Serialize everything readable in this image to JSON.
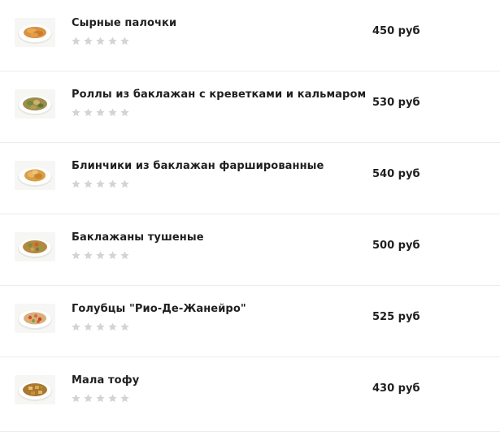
{
  "menu": {
    "items": [
      {
        "name": "Сырные палочки",
        "price": "450 руб",
        "rating": 0,
        "max_rating": 5,
        "image_icon": "cheese-sticks-dish-photo"
      },
      {
        "name": "Роллы из баклажан с креветками и кальмаром",
        "price": "530 руб",
        "rating": 0,
        "max_rating": 5,
        "image_icon": "eggplant-rolls-dish-photo"
      },
      {
        "name": "Блинчики из баклажан фаршированные",
        "price": "540 руб",
        "rating": 0,
        "max_rating": 5,
        "image_icon": "eggplant-pancakes-dish-photo"
      },
      {
        "name": "Баклажаны тушеные",
        "price": "500 руб",
        "rating": 0,
        "max_rating": 5,
        "image_icon": "stewed-eggplant-dish-photo"
      },
      {
        "name": "Голубцы \"Рио-Де-Жанейро\"",
        "price": "525 руб",
        "rating": 0,
        "max_rating": 5,
        "image_icon": "cabbage-rolls-dish-photo"
      },
      {
        "name": "Мала тофу",
        "price": "430 руб",
        "rating": 0,
        "max_rating": 5,
        "image_icon": "mala-tofu-dish-photo"
      }
    ]
  },
  "colors": {
    "text": "#1f1f1f",
    "star_empty": "#d4d4d4",
    "divider": "#ececec",
    "plate": "#ffffff",
    "thumb_bg": "#f6f6f4"
  }
}
